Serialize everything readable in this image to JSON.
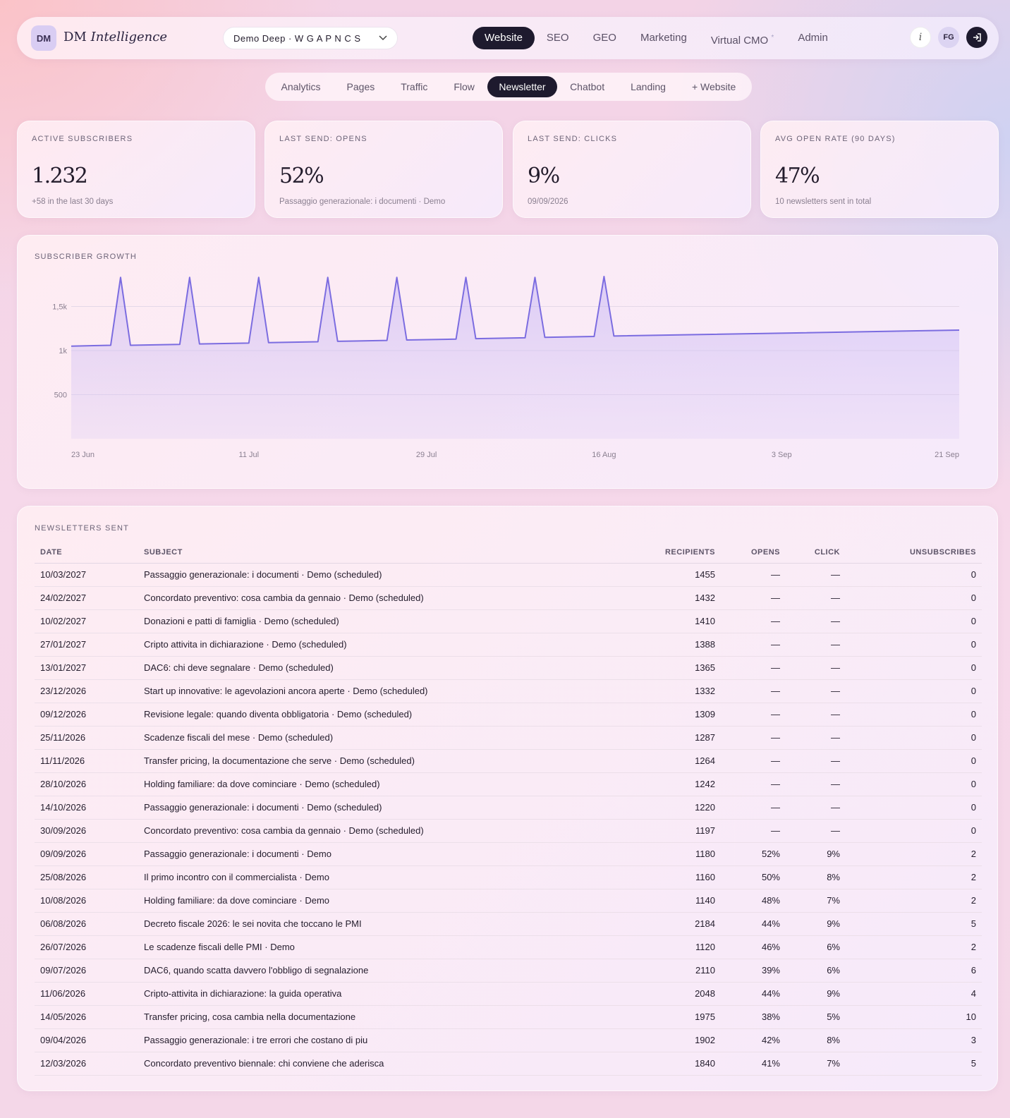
{
  "brand": {
    "badge": "DM",
    "name_part1": "DM",
    "name_part2": "Intelligence"
  },
  "site_select": {
    "value": "Demo Deep · W G A P N C S"
  },
  "main_nav": [
    {
      "label": "Website",
      "active": true
    },
    {
      "label": "SEO",
      "active": false
    },
    {
      "label": "GEO",
      "active": false
    },
    {
      "label": "Marketing",
      "active": false
    },
    {
      "label": "Virtual CMO",
      "active": false,
      "marker": "*"
    },
    {
      "label": "Admin",
      "active": false
    }
  ],
  "user": {
    "info": "i",
    "initials": "FG"
  },
  "sub_nav": [
    {
      "label": "Analytics",
      "active": false
    },
    {
      "label": "Pages",
      "active": false
    },
    {
      "label": "Traffic",
      "active": false
    },
    {
      "label": "Flow",
      "active": false
    },
    {
      "label": "Newsletter",
      "active": true
    },
    {
      "label": "Chatbot",
      "active": false
    },
    {
      "label": "Landing",
      "active": false
    },
    {
      "label": "+ Website",
      "active": false
    }
  ],
  "kpis": [
    {
      "label": "Active subscribers",
      "value": "1.232",
      "sub": "+58 in the last 30 days"
    },
    {
      "label": "Last send: opens",
      "value": "52%",
      "sub": "Passaggio generazionale: i documenti · Demo"
    },
    {
      "label": "Last send: clicks",
      "value": "9%",
      "sub": "09/09/2026"
    },
    {
      "label": "Avg open rate (90 days)",
      "value": "47%",
      "sub": "10 newsletters sent in total"
    }
  ],
  "chart_title": "Subscriber growth",
  "chart_data": {
    "type": "area",
    "title": "Subscriber growth",
    "xlabel": "",
    "ylabel": "",
    "x_ticks": [
      "23 Jun",
      "11 Jul",
      "29 Jul",
      "16 Aug",
      "3 Sep",
      "21 Sep"
    ],
    "y_ticks": [
      "500",
      "1k",
      "1,5k"
    ],
    "ylim": [
      0,
      1850
    ],
    "grid": true,
    "color": "#7b6ce0",
    "x_days": [
      0,
      4,
      5,
      6,
      11,
      12,
      13,
      18,
      19,
      20,
      25,
      26,
      27,
      32,
      33,
      34,
      39,
      40,
      41,
      46,
      47,
      48,
      53,
      54,
      55,
      90
    ],
    "y": [
      1050,
      1060,
      1830,
      1060,
      1070,
      1830,
      1075,
      1085,
      1830,
      1090,
      1100,
      1830,
      1105,
      1115,
      1830,
      1120,
      1130,
      1830,
      1135,
      1145,
      1830,
      1150,
      1160,
      1840,
      1165,
      1232
    ]
  },
  "table_title": "Newsletters sent",
  "table": {
    "headers": {
      "date": "DATE",
      "subject": "SUBJECT",
      "recipients": "RECIPIENTS",
      "opens": "OPENS",
      "click": "CLICK",
      "unsubscribes": "UNSUBSCRIBES"
    },
    "rows": [
      [
        "10/03/2027",
        "Passaggio generazionale: i documenti · Demo (scheduled)",
        "1455",
        "—",
        "—",
        "0"
      ],
      [
        "24/02/2027",
        "Concordato preventivo: cosa cambia da gennaio · Demo (scheduled)",
        "1432",
        "—",
        "—",
        "0"
      ],
      [
        "10/02/2027",
        "Donazioni e patti di famiglia · Demo (scheduled)",
        "1410",
        "—",
        "—",
        "0"
      ],
      [
        "27/01/2027",
        "Cripto attivita in dichiarazione · Demo (scheduled)",
        "1388",
        "—",
        "—",
        "0"
      ],
      [
        "13/01/2027",
        "DAC6: chi deve segnalare · Demo (scheduled)",
        "1365",
        "—",
        "—",
        "0"
      ],
      [
        "23/12/2026",
        "Start up innovative: le agevolazioni ancora aperte · Demo (scheduled)",
        "1332",
        "—",
        "—",
        "0"
      ],
      [
        "09/12/2026",
        "Revisione legale: quando diventa obbligatoria · Demo (scheduled)",
        "1309",
        "—",
        "—",
        "0"
      ],
      [
        "25/11/2026",
        "Scadenze fiscali del mese · Demo (scheduled)",
        "1287",
        "—",
        "—",
        "0"
      ],
      [
        "11/11/2026",
        "Transfer pricing, la documentazione che serve · Demo (scheduled)",
        "1264",
        "—",
        "—",
        "0"
      ],
      [
        "28/10/2026",
        "Holding familiare: da dove cominciare · Demo (scheduled)",
        "1242",
        "—",
        "—",
        "0"
      ],
      [
        "14/10/2026",
        "Passaggio generazionale: i documenti · Demo (scheduled)",
        "1220",
        "—",
        "—",
        "0"
      ],
      [
        "30/09/2026",
        "Concordato preventivo: cosa cambia da gennaio · Demo (scheduled)",
        "1197",
        "—",
        "—",
        "0"
      ],
      [
        "09/09/2026",
        "Passaggio generazionale: i documenti · Demo",
        "1180",
        "52%",
        "9%",
        "2"
      ],
      [
        "25/08/2026",
        "Il primo incontro con il commercialista · Demo",
        "1160",
        "50%",
        "8%",
        "2"
      ],
      [
        "10/08/2026",
        "Holding familiare: da dove cominciare · Demo",
        "1140",
        "48%",
        "7%",
        "2"
      ],
      [
        "06/08/2026",
        "Decreto fiscale 2026: le sei novita che toccano le PMI",
        "2184",
        "44%",
        "9%",
        "5"
      ],
      [
        "26/07/2026",
        "Le scadenze fiscali delle PMI · Demo",
        "1120",
        "46%",
        "6%",
        "2"
      ],
      [
        "09/07/2026",
        "DAC6, quando scatta davvero l'obbligo di segnalazione",
        "2110",
        "39%",
        "6%",
        "6"
      ],
      [
        "11/06/2026",
        "Cripto-attivita in dichiarazione: la guida operativa",
        "2048",
        "44%",
        "9%",
        "4"
      ],
      [
        "14/05/2026",
        "Transfer pricing, cosa cambia nella documentazione",
        "1975",
        "38%",
        "5%",
        "10"
      ],
      [
        "09/04/2026",
        "Passaggio generazionale: i tre errori che costano di piu",
        "1902",
        "42%",
        "8%",
        "3"
      ],
      [
        "12/03/2026",
        "Concordato preventivo biennale: chi conviene che aderisca",
        "1840",
        "41%",
        "7%",
        "5"
      ]
    ]
  }
}
